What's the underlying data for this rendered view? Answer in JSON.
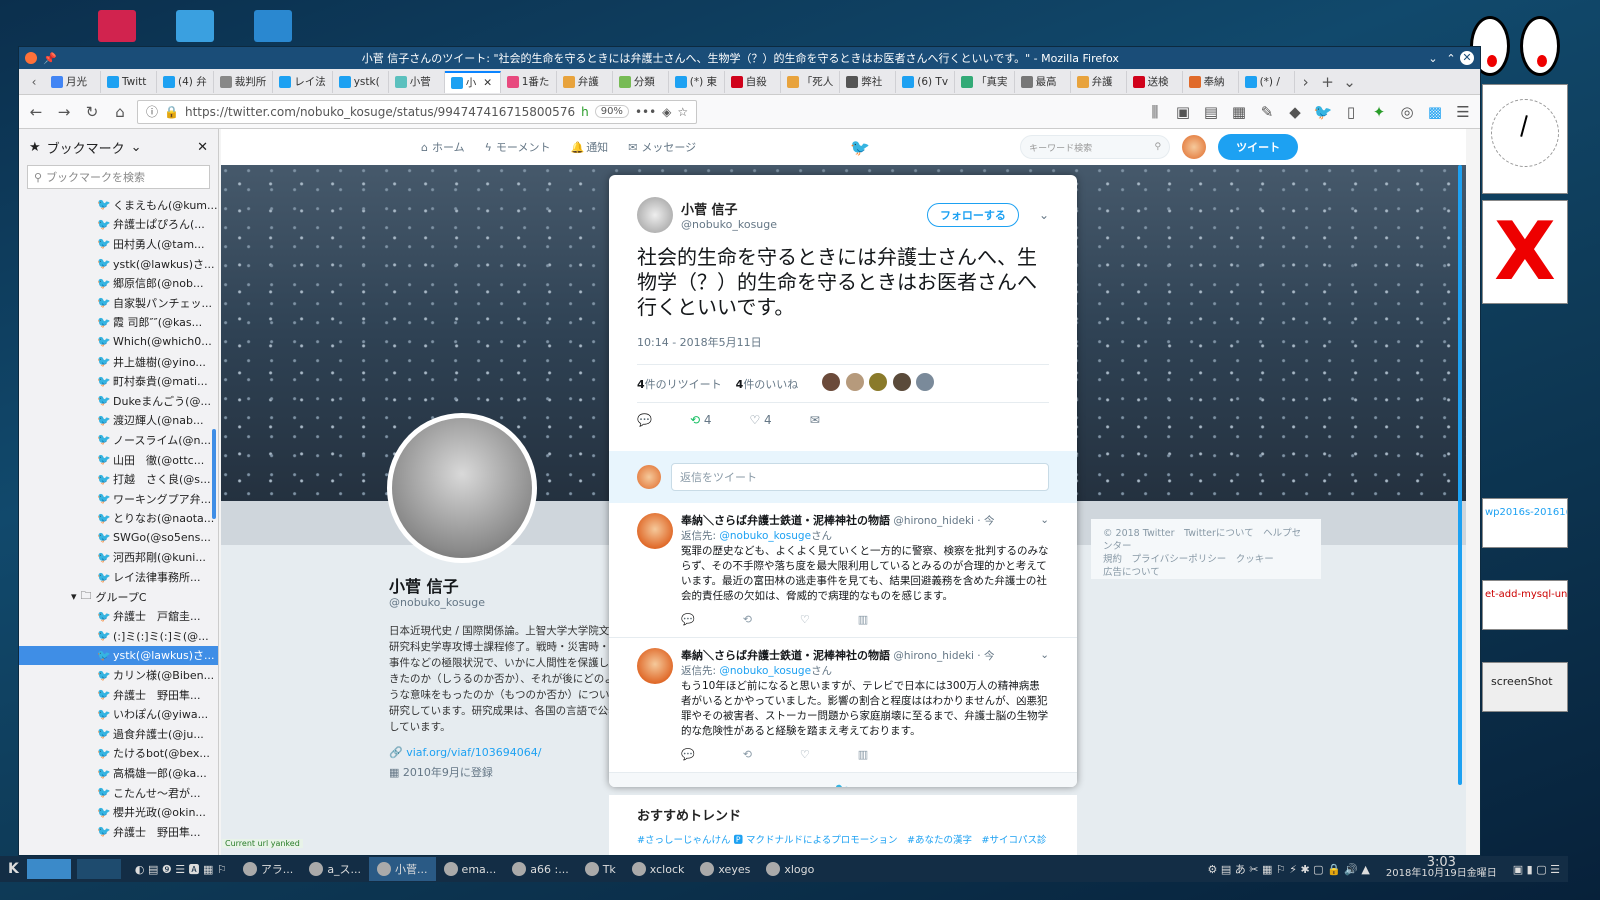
{
  "window": {
    "title": "小菅 信子さんのツイート: \"社会的生命を守るときには弁護士さんへ、生物学（？）的生命を守るときはお医者さんへ行くといいです。\" - Mozilla Firefox"
  },
  "tabs": [
    {
      "label": "月光",
      "color": "#4285f4",
      "icon": "G"
    },
    {
      "label": "Twitt",
      "color": "#1da1f2",
      "icon": "t"
    },
    {
      "label": "(4) 弁",
      "color": "#1da1f2",
      "icon": "t"
    },
    {
      "label": "裁判所",
      "color": "#888",
      "icon": ""
    },
    {
      "label": "レイ法",
      "color": "#1da1f2",
      "icon": "t"
    },
    {
      "label": "ystk(",
      "color": "#1da1f2",
      "icon": "t"
    },
    {
      "label": "小菅",
      "color": "#5bc0be",
      "icon": ""
    },
    {
      "label": "小",
      "color": "#1da1f2",
      "icon": "t",
      "active": true
    },
    {
      "label": "1番た",
      "color": "#e84a7f",
      "icon": ""
    },
    {
      "label": "弁護",
      "color": "#e8a33d",
      "icon": ""
    },
    {
      "label": "分類",
      "color": "#7b5",
      "icon": ""
    },
    {
      "label": "(*) 東",
      "color": "#1da1f2",
      "icon": "t"
    },
    {
      "label": "自殺",
      "color": "#d0021b",
      "icon": "Y"
    },
    {
      "label": "「死人",
      "color": "#e8a33d",
      "icon": ""
    },
    {
      "label": "弊社",
      "color": "#555",
      "icon": ""
    },
    {
      "label": "(6) Tv",
      "color": "#1da1f2",
      "icon": "t"
    },
    {
      "label": "「真実",
      "color": "#3a7",
      "icon": ""
    },
    {
      "label": "最高",
      "color": "#777",
      "icon": ""
    },
    {
      "label": "弁護",
      "color": "#e8a33d",
      "icon": ""
    },
    {
      "label": "送検",
      "color": "#d0021b",
      "icon": "Y"
    },
    {
      "label": "奉納",
      "color": "#e06a2a",
      "icon": ""
    },
    {
      "label": "(*) /",
      "color": "#1da1f2",
      "icon": "t"
    }
  ],
  "nav": {
    "url": "https://twitter.com/nobuko_kosuge/status/994747416715800576",
    "zoom": "90%",
    "hint": "h"
  },
  "sidebar": {
    "title": "ブックマーク",
    "search_placeholder": "ブックマークを検索",
    "items": [
      "くまえもん(@kum...",
      "弁護士ぱぴろん(...",
      "田村勇人(@tam...",
      "ystk(@lawkus)さ...",
      "郷原信郎(@nob...",
      "自家製パンチェッ...",
      "霞 司郎″″(@kas...",
      "Which(@which0...",
      "井上雄樹(@yino...",
      "町村泰貴(@mati...",
      "Dukeまんごう(@...",
      "渡辺輝人(@nab...",
      "ノースライム(@n...",
      "山田　徹(@ottc...",
      "打越　さく良(@s...",
      "ワーキングプア弁...",
      "とりなお(@naota...",
      "SWGo(@so5ens...",
      "河西邦剛(@kuni...",
      "レイ法律事務所..."
    ],
    "folder": "グループC",
    "items2": [
      "弁護士　戸舘圭...",
      "(:]ミ(:]ミ(:]ミ(@...",
      "ystk(@lawkus)さ...",
      "カリン様(@Biben...",
      "弁護士　野田隼...",
      "いわぽん(@yiwa...",
      "過食弁護士(@ju...",
      "たけるbot(@bex...",
      "高橋雄一郎(@ka...",
      "こたんせ～君が...",
      "櫻井光政(@okin...",
      "弁護士　野田隼..."
    ],
    "selected_index2": 2
  },
  "twitter_nav": {
    "home": "ホーム",
    "moments": "モーメント",
    "notifications": "通知",
    "messages": "メッセージ",
    "search_placeholder": "キーワード検索",
    "tweet_button": "ツイート"
  },
  "profile": {
    "name": "小菅 信子",
    "handle": "@nobuko_kosuge",
    "bio": "日本近現代史 / 国際関係論。上智大学大学院文学研究科史学専攻博士課程修了。戦時・災害時・大事件などの極限状況で、いかに人間性を保護してきたのか（しうるのか否か）、それが後にどのような意味をもったのか（もつのか否か）について研究しています。研究成果は、各国の言語で公表しています。",
    "link": "viaf.org/viaf/103694064/",
    "joined": "2010年9月に登録"
  },
  "tweet": {
    "name": "小菅 信子",
    "handle": "@nobuko_kosuge",
    "follow_label": "フォローする",
    "text": "社会的生命を守るときには弁護士さんへ、生物学（？）的生命を守るときはお医者さんへ行くといいです。",
    "time": "10:14 - 2018年5月11日",
    "retweets_count": "4",
    "retweets_label": "件のリツイート",
    "likes_count": "4",
    "likes_label": "件のいいね",
    "retweet_action_count": "4",
    "like_action_count": "4",
    "reply_placeholder": "返信をツイート"
  },
  "replies": [
    {
      "name": "奉納＼さらば弁護士鉄道・泥棒神社の物語",
      "handle": "@hirono_hideki",
      "time": "· 今",
      "to_label": "返信先:",
      "to": "@nobuko_kosuge",
      "to_suffix": "さん",
      "text": "冤罪の歴史なども、よくよく見ていくと一方的に警察、検察を批判するのみならず、その不手際や落ち度を最大限利用しているとみるのが合理的かと考えています。最近の富田林の逃走事件を見ても、結果回避義務を含めた弁護士の社会的責任感の欠如は、脅威的で病理的なものを感じます。"
    },
    {
      "name": "奉納＼さらば弁護士鉄道・泥棒神社の物語",
      "handle": "@hirono_hideki",
      "time": "· 今",
      "to_label": "返信先:",
      "to": "@nobuko_kosuge",
      "to_suffix": "さん",
      "text": "もう10年ほど前になると思いますが、テレビで日本には300万人の精神病患者がいるとかやっていました。影響の割合と程度ははわかりませんが、凶悪犯罪やその被害者、ストーカー問題から家庭崩壊に至るまで、弁護士脳の生物学的な危険性があると経験を踏まえ考えております。"
    }
  ],
  "footer": {
    "line1": "© 2018 Twitter　Twitterについて　ヘルプセンター",
    "line2": "規約　プライバシーポリシー　クッキー",
    "line3": "広告について"
  },
  "trends": {
    "title": "おすすめトレンド",
    "items": "#さっしーじゃんけん 🅿 マクドナルドによるプロモーション　#あなたの漢字　#サイコパス診"
  },
  "status": "Current url yanked",
  "right_panel": {
    "item1": "wp2016s-20161(",
    "item2": "et-add-mysql-uni",
    "screenshot_label": "screenShot"
  },
  "taskbar": {
    "items": [
      "アラ...",
      "a_ス...",
      "小菅...",
      "ema...",
      "a66 :...",
      "Tk",
      "xclock",
      "xeyes",
      "xlogo"
    ],
    "time": "3:03",
    "date": "2018年10月19日金曜日"
  }
}
